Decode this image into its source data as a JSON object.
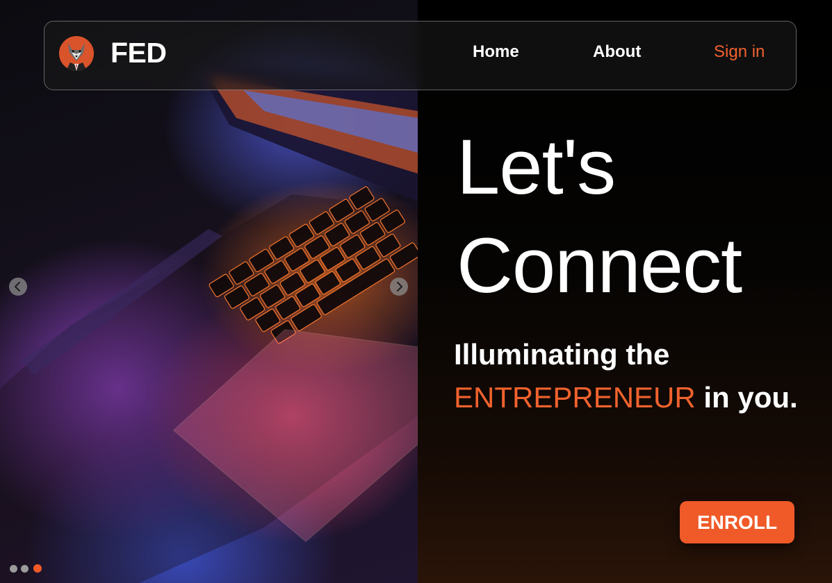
{
  "brand": {
    "name": "FED",
    "logo_icon": "wolf-mascot-icon"
  },
  "nav": {
    "items": [
      {
        "label": "Home"
      },
      {
        "label": "About"
      },
      {
        "label": "Sign in"
      }
    ]
  },
  "hero": {
    "headline_line1": "Let's",
    "headline_line2": "Connect",
    "tagline_line1": "Illuminating the",
    "tagline_accent": "ENTREPRENEUR",
    "tagline_rest": "in you.",
    "cta_label": "ENROLL"
  },
  "carousel": {
    "prev_icon": "chevron-left-icon",
    "next_icon": "chevron-right-icon",
    "slide_count": 3,
    "active_slide": 3
  },
  "colors": {
    "accent": "#f05a28",
    "text": "#ffffff",
    "background": "#000000"
  }
}
